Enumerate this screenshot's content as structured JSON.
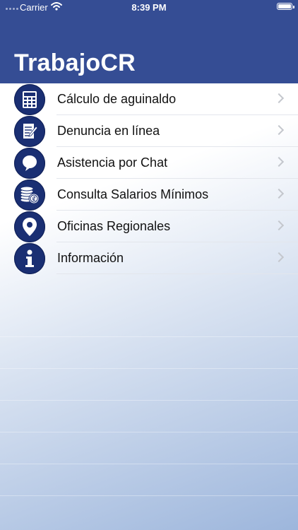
{
  "status_bar": {
    "carrier": "Carrier",
    "time": "8:39 PM"
  },
  "header": {
    "title": "TrabajoCR"
  },
  "menu": {
    "items": [
      {
        "label": "Cálculo de aguinaldo",
        "icon": "calculator-icon"
      },
      {
        "label": "Denuncia en línea",
        "icon": "document-pen-icon"
      },
      {
        "label": "Asistencia por Chat",
        "icon": "chat-bubble-icon"
      },
      {
        "label": "Consulta Salarios Mínimos",
        "icon": "coins-icon"
      },
      {
        "label": "Oficinas Regionales",
        "icon": "map-pin-icon"
      },
      {
        "label": "Información",
        "icon": "info-icon"
      }
    ]
  },
  "colors": {
    "header": "#354d94",
    "icon_bg": "#1a2f73"
  }
}
